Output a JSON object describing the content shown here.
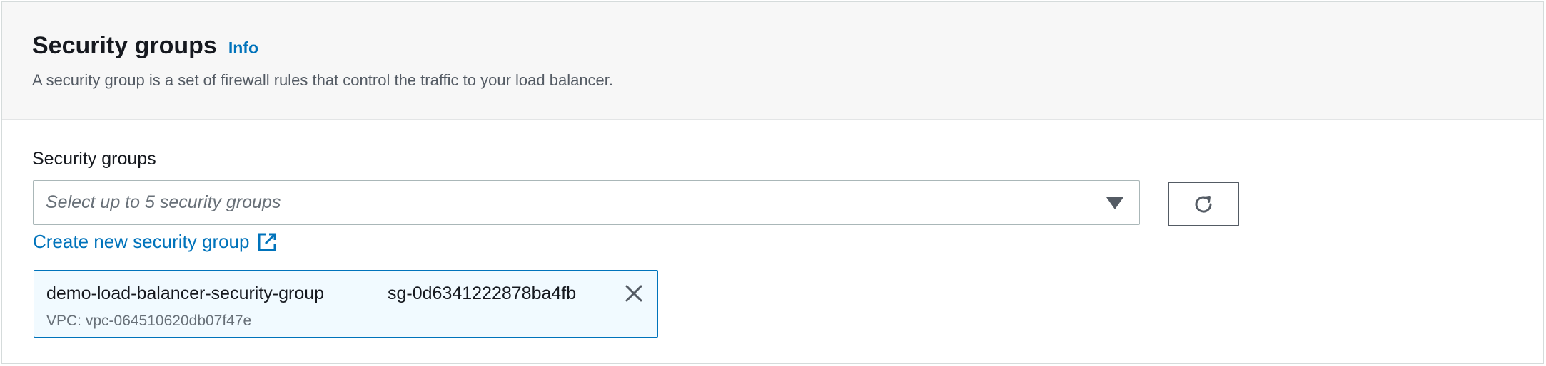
{
  "header": {
    "title": "Security groups",
    "info_link": "Info",
    "description": "A security group is a set of firewall rules that control the traffic to your load balancer."
  },
  "field": {
    "label": "Security groups",
    "placeholder": "Select up to 5 security groups",
    "caret_icon": "caret-down-icon",
    "refresh_icon": "refresh-icon"
  },
  "create_link": {
    "label": "Create new security group",
    "icon": "external-link-icon"
  },
  "selected_tokens": [
    {
      "name": "demo-load-balancer-security-group",
      "id": "sg-0d6341222878ba4fb",
      "vpc": "VPC: vpc-064510620db07f47e",
      "dismiss_icon": "close-icon"
    }
  ],
  "colors": {
    "link": "#0073bb",
    "header_bg": "#f7f7f7",
    "token_bg": "#f1faff",
    "token_border": "#0073bb",
    "text_primary": "#16191f",
    "text_secondary": "#545b64",
    "placeholder": "#687078"
  }
}
